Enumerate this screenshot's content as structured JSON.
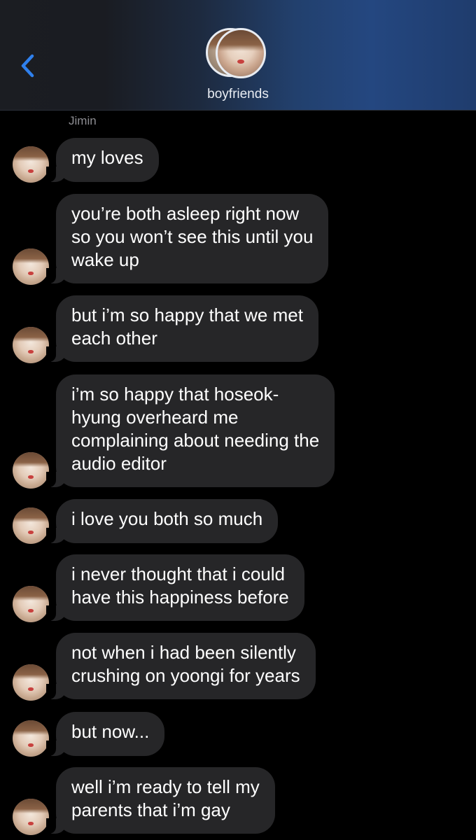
{
  "header": {
    "back_icon": "chevron-left-icon",
    "group_name": "boyfriends",
    "accent_color": "#2f80ed"
  },
  "thread": {
    "sender": "Jimin",
    "messages": [
      {
        "lines": [
          "my loves"
        ]
      },
      {
        "lines": [
          "you’re both asleep right now",
          "so you won’t see this until you",
          "wake up"
        ]
      },
      {
        "lines": [
          "but i’m so happy that we met",
          "each other"
        ]
      },
      {
        "lines": [
          "i’m so happy that hoseok-",
          "hyung overheard me",
          "complaining about needing the",
          "audio editor"
        ]
      },
      {
        "lines": [
          "i love you both so much"
        ]
      },
      {
        "lines": [
          "i never thought that i could",
          "have this happiness before"
        ]
      },
      {
        "lines": [
          "not when i had been silently",
          "crushing on yoongi for years"
        ]
      },
      {
        "lines": [
          "but now..."
        ]
      },
      {
        "lines": [
          "well i’m ready to tell my",
          "parents that i’m gay"
        ]
      }
    ]
  }
}
